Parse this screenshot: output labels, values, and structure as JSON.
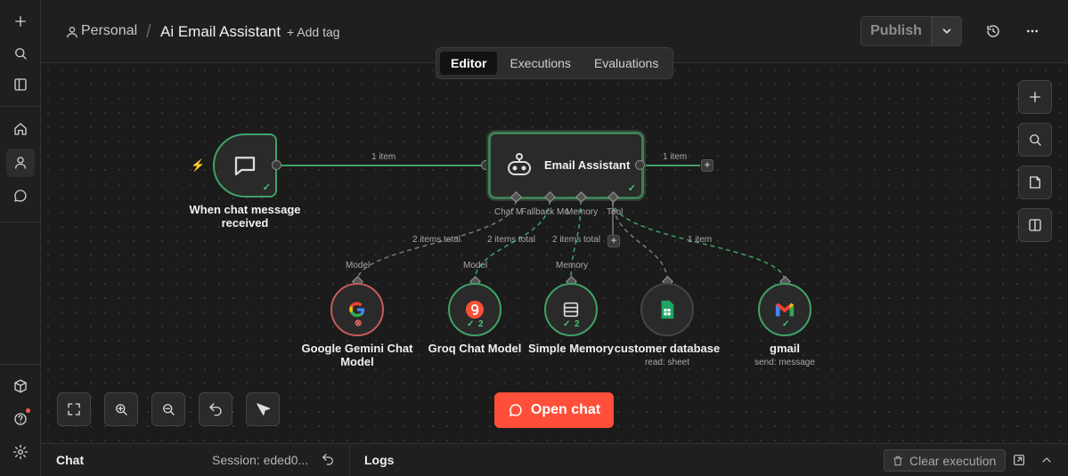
{
  "header": {
    "project": "Personal",
    "workflow_title": "Ai Email Assistant",
    "add_tag": "+ Add tag",
    "publish": "Publish"
  },
  "tabs": [
    {
      "label": "Editor",
      "active": true
    },
    {
      "label": "Executions",
      "active": false
    },
    {
      "label": "Evaluations",
      "active": false
    }
  ],
  "nodes": {
    "trigger": {
      "label": "When chat message received"
    },
    "agent": {
      "label": "Email Assistant"
    },
    "gemini": {
      "label": "Google Gemini Chat Model"
    },
    "groq": {
      "label": "Groq Chat Model",
      "badge": "2"
    },
    "memory": {
      "label": "Simple Memory",
      "badge": "2"
    },
    "customer_db": {
      "label": "customer database",
      "sub": "read: sheet"
    },
    "gmail": {
      "label": "gmail",
      "sub": "send: message"
    }
  },
  "edges": {
    "trigger_to_agent": "1 item",
    "agent_out": "1 item",
    "gemini": "2 items total",
    "groq": "2 items total",
    "memory": "2 items total",
    "gmail": "1 item"
  },
  "agent_ports": {
    "chat_model": "Chat M",
    "fallback_model": "Fallback Mo",
    "memory": "Memory",
    "tool": "Tool"
  },
  "sub_port_labels": {
    "gemini": "Model",
    "groq": "Model",
    "memory": "Memory"
  },
  "open_chat": "Open chat",
  "bottom": {
    "chat": "Chat",
    "session": "Session: eded0...",
    "logs": "Logs",
    "clear_execution": "Clear execution"
  },
  "colors": {
    "success": "#3fa266",
    "error": "#c45a5a",
    "accent": "#ff4f3a"
  }
}
